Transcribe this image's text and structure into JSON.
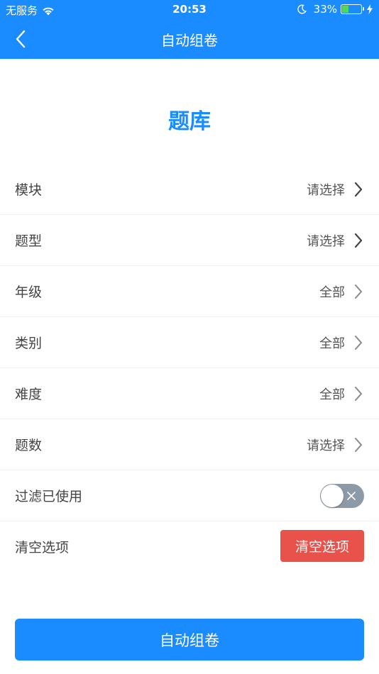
{
  "colors": {
    "primary": "#1a8cff",
    "danger": "#e8524a",
    "toggle_off": "#8c9aa8",
    "battery_fill": "#4cd964"
  },
  "status_bar": {
    "carrier": "无服务",
    "time": "20:53",
    "battery_percent_text": "33%",
    "battery_level": 0.33,
    "icons": [
      "wifi-icon",
      "moon-icon",
      "battery-icon",
      "charging-bolt-icon"
    ]
  },
  "nav": {
    "title": "自动组卷",
    "back_icon": "chevron-left-icon"
  },
  "section_title": "题库",
  "rows": [
    {
      "label": "模块",
      "value": "请选择"
    },
    {
      "label": "题型",
      "value": "请选择"
    },
    {
      "label": "年级",
      "value": "全部"
    },
    {
      "label": "类别",
      "value": "全部"
    },
    {
      "label": "难度",
      "value": "全部"
    },
    {
      "label": "题数",
      "value": "请选择"
    }
  ],
  "filter_row": {
    "label": "过滤已使用",
    "toggle_on": false
  },
  "clear_row": {
    "label": "清空选项",
    "button_label": "清空选项"
  },
  "submit_button": "自动组卷"
}
